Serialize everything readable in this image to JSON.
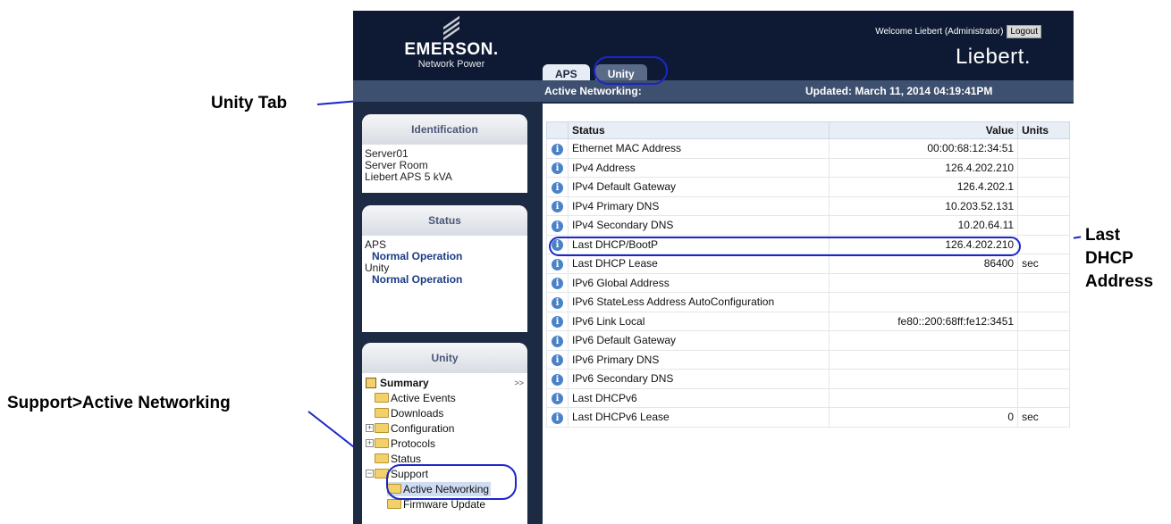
{
  "annotations": {
    "unity_tab": "Unity Tab",
    "last_dhcp": [
      "Last",
      "DHCP",
      "Address"
    ],
    "support_nav": "Support>Active Networking",
    "line_color": "#1c26c8"
  },
  "header": {
    "brand": "EMERSON.",
    "brand_sub": "Network Power",
    "welcome": "Welcome Liebert (Administrator)",
    "logout": "Logout",
    "product": "Liebert."
  },
  "tabs": [
    {
      "label": "APS"
    },
    {
      "label": "Unity"
    }
  ],
  "subbar": {
    "title": "Active Networking:",
    "updated": "Updated: March 11, 2014 04:19:41PM"
  },
  "identification": {
    "title": "Identification",
    "lines": [
      "Server01",
      "Server Room",
      "Liebert APS 5 kVA"
    ]
  },
  "status_panel": {
    "title": "Status",
    "aps_label": "APS",
    "aps_value": "Normal Operation",
    "unity_label": "Unity",
    "unity_value": "Normal Operation"
  },
  "unity_panel": {
    "title": "Unity",
    "collapse": ">>",
    "summary": "Summary",
    "items": {
      "active_events": "Active Events",
      "downloads": "Downloads",
      "configuration": "Configuration",
      "protocols": "Protocols",
      "status": "Status",
      "support": "Support",
      "active_networking": "Active Networking",
      "firmware_update": "Firmware Update"
    }
  },
  "table": {
    "headers": {
      "status": "Status",
      "value": "Value",
      "units": "Units"
    },
    "rows": [
      {
        "status": "Ethernet MAC Address",
        "value": "00:00:68:12:34:51",
        "units": ""
      },
      {
        "status": "IPv4 Address",
        "value": "126.4.202.210",
        "units": ""
      },
      {
        "status": "IPv4 Default Gateway",
        "value": "126.4.202.1",
        "units": ""
      },
      {
        "status": "IPv4 Primary DNS",
        "value": "10.203.52.131",
        "units": ""
      },
      {
        "status": "IPv4 Secondary DNS",
        "value": "10.20.64.11",
        "units": ""
      },
      {
        "status": "Last DHCP/BootP",
        "value": "126.4.202.210",
        "units": ""
      },
      {
        "status": "Last DHCP Lease",
        "value": "86400",
        "units": "sec"
      },
      {
        "status": "IPv6 Global Address",
        "value": "",
        "units": ""
      },
      {
        "status": "IPv6 StateLess Address AutoConfiguration",
        "value": "",
        "units": ""
      },
      {
        "status": "IPv6 Link Local",
        "value": "fe80::200:68ff:fe12:3451",
        "units": ""
      },
      {
        "status": "IPv6 Default Gateway",
        "value": "",
        "units": ""
      },
      {
        "status": "IPv6 Primary DNS",
        "value": "",
        "units": ""
      },
      {
        "status": "IPv6 Secondary DNS",
        "value": "",
        "units": ""
      },
      {
        "status": "Last DHCPv6",
        "value": "",
        "units": ""
      },
      {
        "status": "Last DHCPv6 Lease",
        "value": "0",
        "units": "sec"
      }
    ]
  }
}
